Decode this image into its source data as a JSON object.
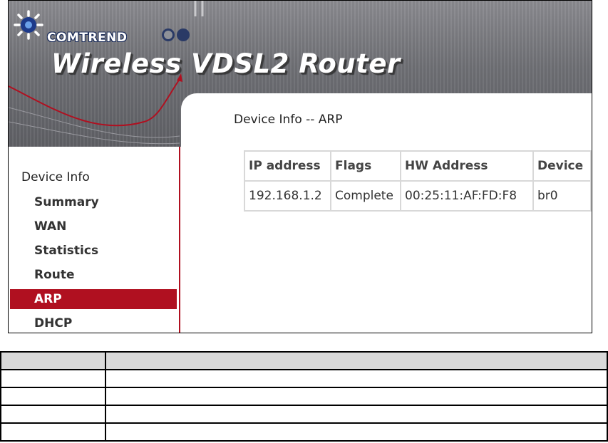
{
  "banner": {
    "brand": "COMTREND",
    "product_title": "Wireless VDSL2 Router"
  },
  "sidebar": {
    "heading": "Device Info",
    "items": [
      {
        "label": "Summary",
        "active": false
      },
      {
        "label": "WAN",
        "active": false
      },
      {
        "label": "Statistics",
        "active": false
      },
      {
        "label": "Route",
        "active": false
      },
      {
        "label": "ARP",
        "active": true
      },
      {
        "label": "DHCP",
        "active": false
      }
    ]
  },
  "main": {
    "heading": "Device Info -- ARP",
    "arp_table": {
      "columns": [
        "IP address",
        "Flags",
        "HW Address",
        "Device"
      ],
      "rows": [
        [
          "192.168.1.2",
          "Complete",
          "00:25:11:AF:FD:F8",
          "br0"
        ]
      ]
    }
  },
  "colors": {
    "accent": "#b01020",
    "brand_blue": "#2a3a66",
    "banner_gray": "#6f7075"
  },
  "icons": {
    "logo": "comtrend-logo-icon"
  }
}
